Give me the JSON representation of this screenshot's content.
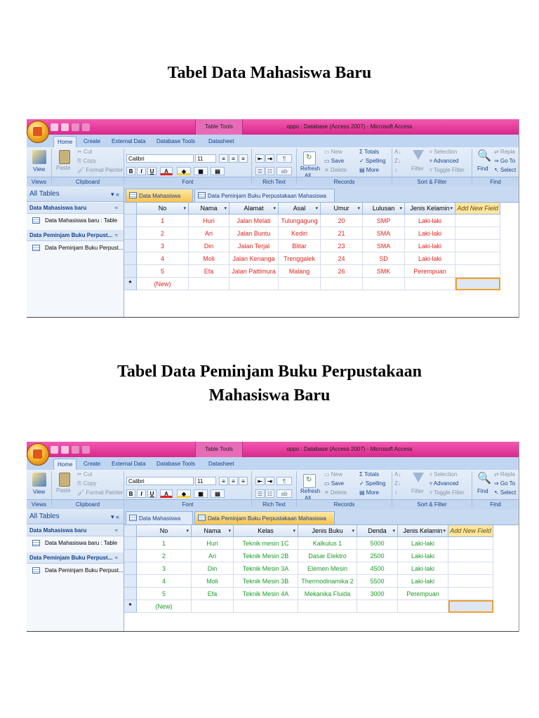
{
  "doc": {
    "title1": "Tabel Data Mahasiswa Baru",
    "title2_line1": "Tabel Data Peminjam Buku Perpustakaan",
    "title2_line2": "Mahasiswa Baru"
  },
  "app": {
    "table_tools": "Table Tools",
    "window_title": "oppo : Database (Access 2007) - Microsoft Access",
    "tabs": [
      "Home",
      "Create",
      "External Data",
      "Database Tools",
      "Datasheet"
    ],
    "ribbon": {
      "view": "View",
      "paste": "Paste",
      "cut": "Cut",
      "copy": "Copy",
      "format_painter": "Format Painter",
      "font_name": "Calibri",
      "font_size": "11",
      "bold": "B",
      "italic": "I",
      "underline": "U",
      "font_color": "A",
      "refresh": "Refresh",
      "refresh_all": "All",
      "new": "New",
      "save": "Save",
      "delete": "Delete",
      "totals": "Totals",
      "spelling": "Spelling",
      "more": "More",
      "filter": "Filter",
      "selection": "Selection",
      "advanced": "Advanced",
      "toggle_filter": "Toggle Filter",
      "find": "Find",
      "replace": "Repla",
      "goto": "Go To",
      "select": "Select",
      "groups": [
        "Views",
        "Clipboard",
        "Font",
        "Rich Text",
        "Records",
        "Sort & Filter",
        "Find"
      ]
    },
    "nav": {
      "header": "All Tables",
      "groups": [
        {
          "label": "Data Mahasiswa baru",
          "item": "Data Mahasiswa baru : Table"
        },
        {
          "label": "Data Peminjam Buku Perpust...",
          "item": "Data Peminjam Buku Perpust..."
        }
      ]
    },
    "doc_tabs": [
      "Data Mahasiswa baru",
      "Data Peminjam Buku Perpustakaan Mahasiswa Baru"
    ]
  },
  "table1": {
    "headers": [
      "No",
      "Nama",
      "Alamat",
      "Asal",
      "Umur",
      "Lulusan",
      "Jenis Kelamin",
      "Add New Field"
    ],
    "rows": [
      [
        "1",
        "Huri",
        "Jalan Melati",
        "Tulungagung",
        "20",
        "SMP",
        "Laki-laki"
      ],
      [
        "2",
        "Ari",
        "Jalan Buntu",
        "Kediri",
        "21",
        "SMA",
        "Laki-laki"
      ],
      [
        "3",
        "Din",
        "Jalan Terjal",
        "Blitar",
        "23",
        "SMA",
        "Laki-laki"
      ],
      [
        "4",
        "Moli",
        "Jalan Kenanga",
        "Trenggalek",
        "24",
        "SD",
        "Laki-laki"
      ],
      [
        "5",
        "Efa",
        "Jalan Pattimura",
        "Malang",
        "26",
        "SMK",
        "Perempuan"
      ]
    ],
    "new_row": "(New)",
    "new_marker": "*",
    "color": "#e0241d"
  },
  "table2": {
    "headers": [
      "No",
      "Nama",
      "Kelas",
      "Jenis Buku",
      "Denda",
      "Jenis Kelamin",
      "Add New Field"
    ],
    "rows": [
      [
        "1",
        "Huri",
        "Teknik mesin 1C",
        "Kalkulus 1",
        "5000",
        "Laki-laki"
      ],
      [
        "2",
        "Ari",
        "Teknik Mesin 2B",
        "Dasar Elektro",
        "2500",
        "Laki-laki"
      ],
      [
        "3",
        "Din",
        "Teknik Mesin 3A",
        "Elemen Mesin",
        "4500",
        "Laki-laki"
      ],
      [
        "4",
        "Moli",
        "Teknik Mesin 3B",
        "Thermodinamika 2",
        "5500",
        "Laki-laki"
      ],
      [
        "5",
        "Efa",
        "Teknik Mesin 4A",
        "Mekanika Fluida",
        "3000",
        "Perempuan"
      ]
    ],
    "new_row": "(New)",
    "new_marker": "*",
    "color": "#1d9a2a"
  }
}
